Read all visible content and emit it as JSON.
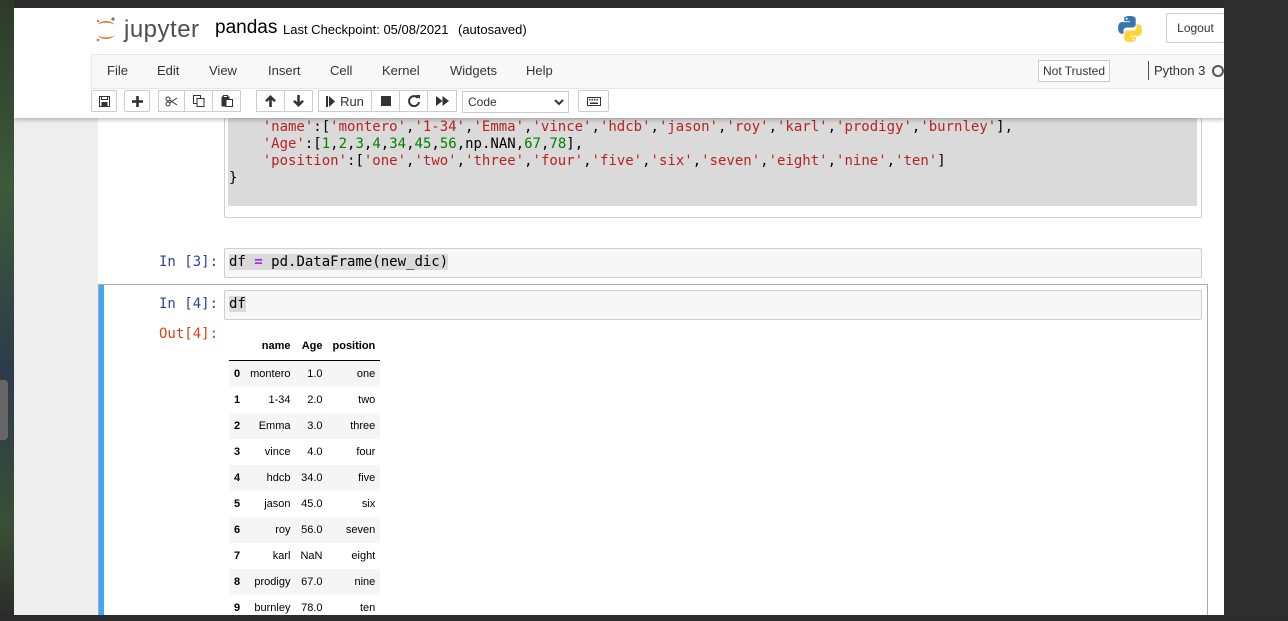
{
  "header": {
    "logo_text": "jupyter",
    "notebook_name": "pandas",
    "checkpoint": "Last Checkpoint: 05/08/2021",
    "autosave_status": "(autosaved)",
    "logout_label": "Logout"
  },
  "menubar": {
    "items": [
      "File",
      "Edit",
      "View",
      "Insert",
      "Cell",
      "Kernel",
      "Widgets",
      "Help"
    ],
    "trust_label": "Not Trusted",
    "kernel_name": "Python 3"
  },
  "toolbar": {
    "run_label": "Run",
    "cell_type": "Code",
    "icons": [
      "save-icon",
      "plus-icon",
      "scissors-icon",
      "copy-icon",
      "paste-icon",
      "arrow-up-icon",
      "arrow-down-icon",
      "run-icon",
      "stop-icon",
      "restart-icon",
      "fast-forward-icon",
      "keyboard-icon"
    ]
  },
  "cells": {
    "cell2_lines": [
      "    'name':['montero','1-34','Emma','vince','hdcb','jason','roy','karl','prodigy','burnley'],",
      "    'Age':[1,2,3,4,34,45,56,np.NAN,67,78],",
      "    'position':['one','two','three','four','five','six','seven','eight','nine','ten']",
      "}"
    ],
    "cell3_prompt": "In [3]:",
    "cell3_code": "df = pd.DataFrame(new_dic)",
    "cell4_prompt": "In [4]:",
    "cell4_code": "df",
    "cell4_out_prompt": "Out[4]:"
  },
  "dataframe": {
    "columns": [
      "name",
      "Age",
      "position"
    ],
    "rows": [
      {
        "index": "0",
        "name": "montero",
        "Age": "1.0",
        "position": "one"
      },
      {
        "index": "1",
        "name": "1-34",
        "Age": "2.0",
        "position": "two"
      },
      {
        "index": "2",
        "name": "Emma",
        "Age": "3.0",
        "position": "three"
      },
      {
        "index": "3",
        "name": "vince",
        "Age": "4.0",
        "position": "four"
      },
      {
        "index": "4",
        "name": "hdcb",
        "Age": "34.0",
        "position": "five"
      },
      {
        "index": "5",
        "name": "jason",
        "Age": "45.0",
        "position": "six"
      },
      {
        "index": "6",
        "name": "roy",
        "Age": "56.0",
        "position": "seven"
      },
      {
        "index": "7",
        "name": "karl",
        "Age": "NaN",
        "position": "eight"
      },
      {
        "index": "8",
        "name": "prodigy",
        "Age": "67.0",
        "position": "nine"
      },
      {
        "index": "9",
        "name": "burnley",
        "Age": "78.0",
        "position": "ten"
      }
    ]
  },
  "colors": {
    "accent_selected": "#42a5f5",
    "in_prompt": "#303f9f",
    "out_prompt": "#d84315",
    "string": "#ba2121",
    "number": "#008000"
  }
}
